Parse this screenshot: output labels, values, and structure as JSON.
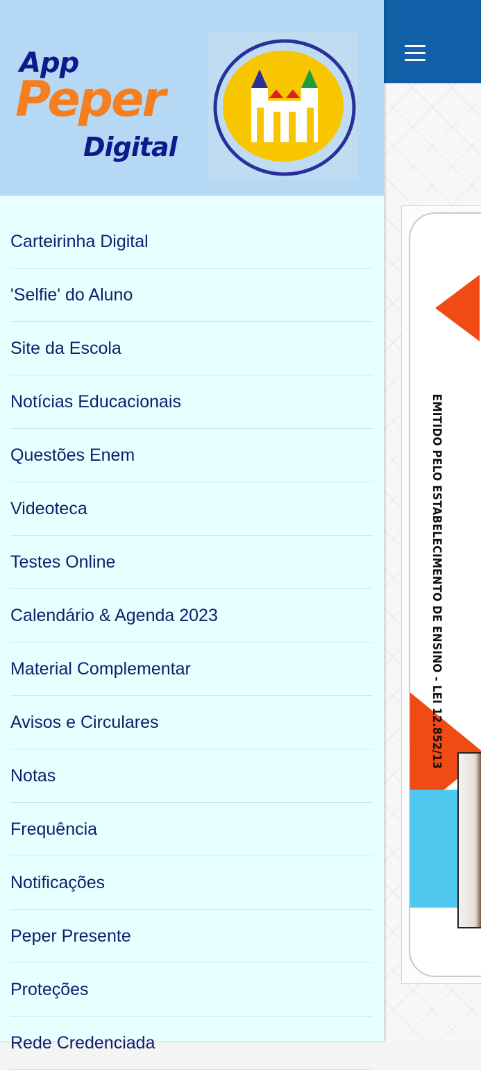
{
  "header": {
    "logo_app": "App",
    "logo_peper": "Peper",
    "logo_digital": "Digital"
  },
  "menu": {
    "items": [
      {
        "label": "Carteirinha Digital"
      },
      {
        "label": "'Selfie' do Aluno"
      },
      {
        "label": "Site da Escola"
      },
      {
        "label": "Notícias Educacionais"
      },
      {
        "label": "Questões Enem"
      },
      {
        "label": "Videoteca"
      },
      {
        "label": "Testes Online"
      },
      {
        "label": "Calendário & Agenda 2023"
      },
      {
        "label": "Material Complementar"
      },
      {
        "label": "Avisos e Circulares"
      },
      {
        "label": "Notas"
      },
      {
        "label": "Frequência"
      },
      {
        "label": "Notificações"
      },
      {
        "label": "Peper Presente"
      },
      {
        "label": "Proteções"
      },
      {
        "label": "Rede Credenciada"
      }
    ]
  },
  "card": {
    "vertical_text": "EMITIDO PELO ESTABELECIMENTO DE ENSINO - LEI 12.852/13"
  },
  "colors": {
    "topbar": "#1160a8",
    "drawer_header": "#b5d9f4",
    "drawer_bg": "#e8ffff",
    "menu_text": "#0c1f6b",
    "logo_orange": "#f57f1f",
    "logo_navy": "#0e1a8c"
  },
  "icons": {
    "menu_toggle": "hamburger-icon",
    "school_logo": "school-castle-logo"
  }
}
